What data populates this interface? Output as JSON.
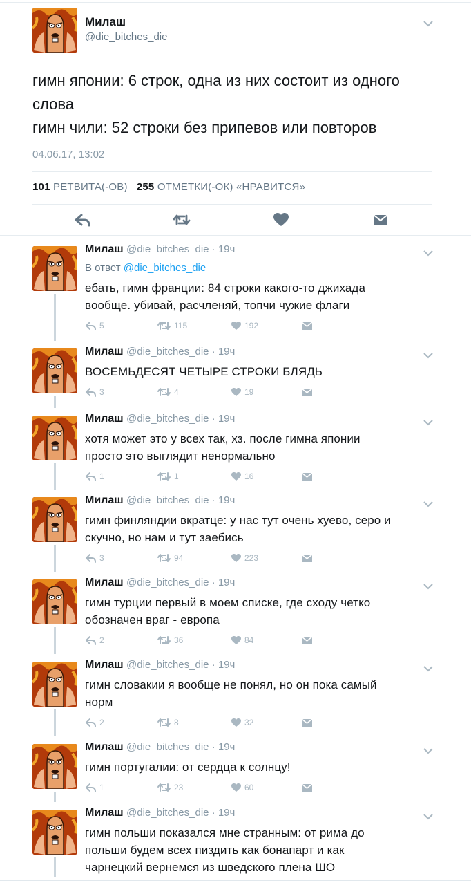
{
  "main_tweet": {
    "name": "Милаш",
    "handle": "@die_bitches_die",
    "text_lines": [
      "гимн японии: 6 строк, одна из них состоит из одного",
      "слова",
      "гимн чили: 52 строки без припевов или повторов"
    ],
    "timestamp": "04.06.17, 13:02",
    "retweets_count": "101",
    "retweets_label": "РЕТВИТА(-ОВ)",
    "likes_count": "255",
    "likes_label": "ОТМЕТКИ(-ОК) «НРАВИТСЯ»",
    "actions": [
      "reply-icon",
      "retweet-icon",
      "heart-icon",
      "dm-envelope-icon"
    ]
  },
  "colors": {
    "accent": "#1da1f2",
    "muted": "#8899a6",
    "icon_gray": "#aab8c2",
    "thread_line": "#ccd6dd",
    "text": "#14171a",
    "avatar_bg": "#c2410c"
  },
  "replies": [
    {
      "name": "Милаш",
      "handle": "@die_bitches_die",
      "time": "19ч",
      "reply_to_label": "В ответ",
      "reply_to_handle": "@die_bitches_die",
      "text_lines": [
        "ебать, гимн франции: 84 строки какого-то джихада",
        "вообще. убивай, расчленяй, топчи чужие флаги"
      ],
      "replies": "5",
      "retweets": "115",
      "likes": "192"
    },
    {
      "name": "Милаш",
      "handle": "@die_bitches_die",
      "time": "19ч",
      "text_lines": [
        "ВОСЕМЬДЕСЯТ ЧЕТЫРЕ СТРОКИ БЛЯДЬ"
      ],
      "replies": "3",
      "retweets": "4",
      "likes": "19"
    },
    {
      "name": "Милаш",
      "handle": "@die_bitches_die",
      "time": "19ч",
      "text_lines": [
        "хотя может это у всех так, хз. после гимна японии",
        "просто это выглядит ненормально"
      ],
      "replies": "1",
      "retweets": "1",
      "likes": "16"
    },
    {
      "name": "Милаш",
      "handle": "@die_bitches_die",
      "time": "19ч",
      "text_lines": [
        "гимн финляндии вкратце: у нас тут очень хуево, серо и",
        "скучно, но нам и тут заебись"
      ],
      "replies": "3",
      "retweets": "94",
      "likes": "223"
    },
    {
      "name": "Милаш",
      "handle": "@die_bitches_die",
      "time": "19ч",
      "text_lines": [
        "гимн турции первый в моем списке, где сходу четко",
        "обозначен враг - европа"
      ],
      "replies": "2",
      "retweets": "36",
      "likes": "84"
    },
    {
      "name": "Милаш",
      "handle": "@die_bitches_die",
      "time": "19ч",
      "text_lines": [
        "гимн словакии я вообще не понял, но он пока самый",
        "норм"
      ],
      "replies": "2",
      "retweets": "8",
      "likes": "32"
    },
    {
      "name": "Милаш",
      "handle": "@die_bitches_die",
      "time": "19ч",
      "text_lines": [
        "гимн португалии: от сердца к солнцу!"
      ],
      "replies": "1",
      "retweets": "23",
      "likes": "60"
    },
    {
      "name": "Милаш",
      "handle": "@die_bitches_die",
      "time": "19ч",
      "text_lines": [
        "гимн польши показался мне странным: от рима до",
        "польши будем всех пиздить как бонапарт и как",
        "чарнецкий вернемся из шведского плена ШО"
      ],
      "replies": "",
      "retweets": "",
      "likes": ""
    }
  ]
}
